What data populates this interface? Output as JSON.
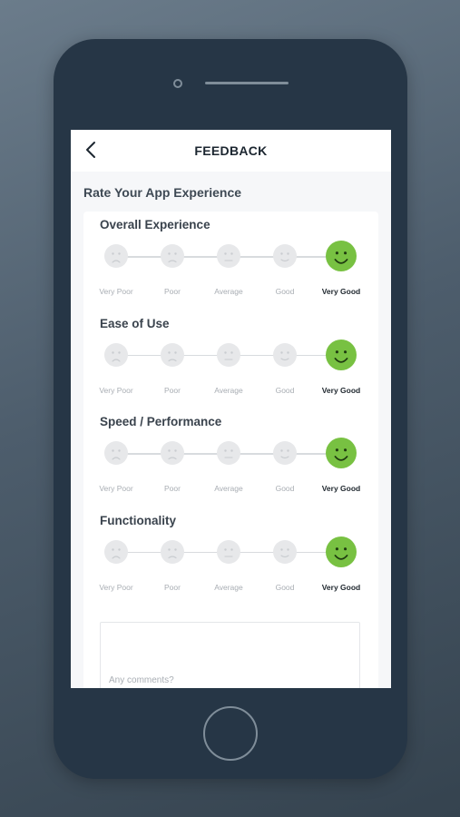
{
  "header": {
    "title": "FEEDBACK",
    "back_icon": "chevron-left-icon"
  },
  "section_title": "Rate Your App Experience",
  "scale_labels": [
    "Very Poor",
    "Poor",
    "Average",
    "Good",
    "Very Good"
  ],
  "questions": [
    {
      "title": "Overall Experience",
      "selected": "Very Good"
    },
    {
      "title": "Ease of Use",
      "selected": "Very Good"
    },
    {
      "title": "Speed / Performance",
      "selected": "Very Good"
    },
    {
      "title": "Functionality",
      "selected": "Very Good"
    }
  ],
  "comments": {
    "placeholder": "Any comments?",
    "value": ""
  },
  "colors": {
    "selected": "#78c142",
    "unselected": "#e7e8ea",
    "phone": "#263646"
  }
}
